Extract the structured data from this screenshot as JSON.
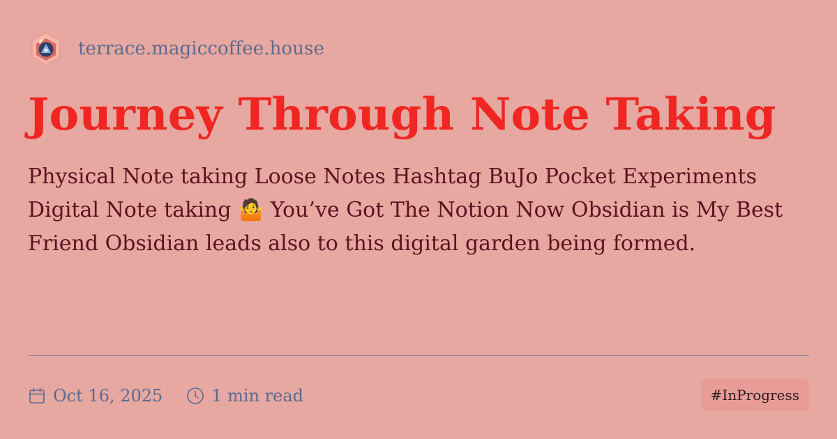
{
  "site": {
    "name": "terrace.magiccoffee.house",
    "logo_icon": "hexagon-logo-icon"
  },
  "title": "Journey Through Note Taking",
  "description": "Physical Note taking Loose Notes Hashtag BuJo Pocket Experiments Digital Note taking 🤷 You’ve Got The Notion Now Obsidian is My Best Friend Obsidian leads also to this digital garden being formed.",
  "meta": {
    "date": "Oct 16, 2025",
    "date_icon": "calendar-icon",
    "read_time": "1 min read",
    "read_time_icon": "clock-icon"
  },
  "tag": "#InProgress",
  "colors": {
    "background": "#e6a8a0",
    "title": "#ef2622",
    "body_text": "#5c1220",
    "muted_text": "#5b6a8f",
    "tag_background": "#e99c97"
  }
}
